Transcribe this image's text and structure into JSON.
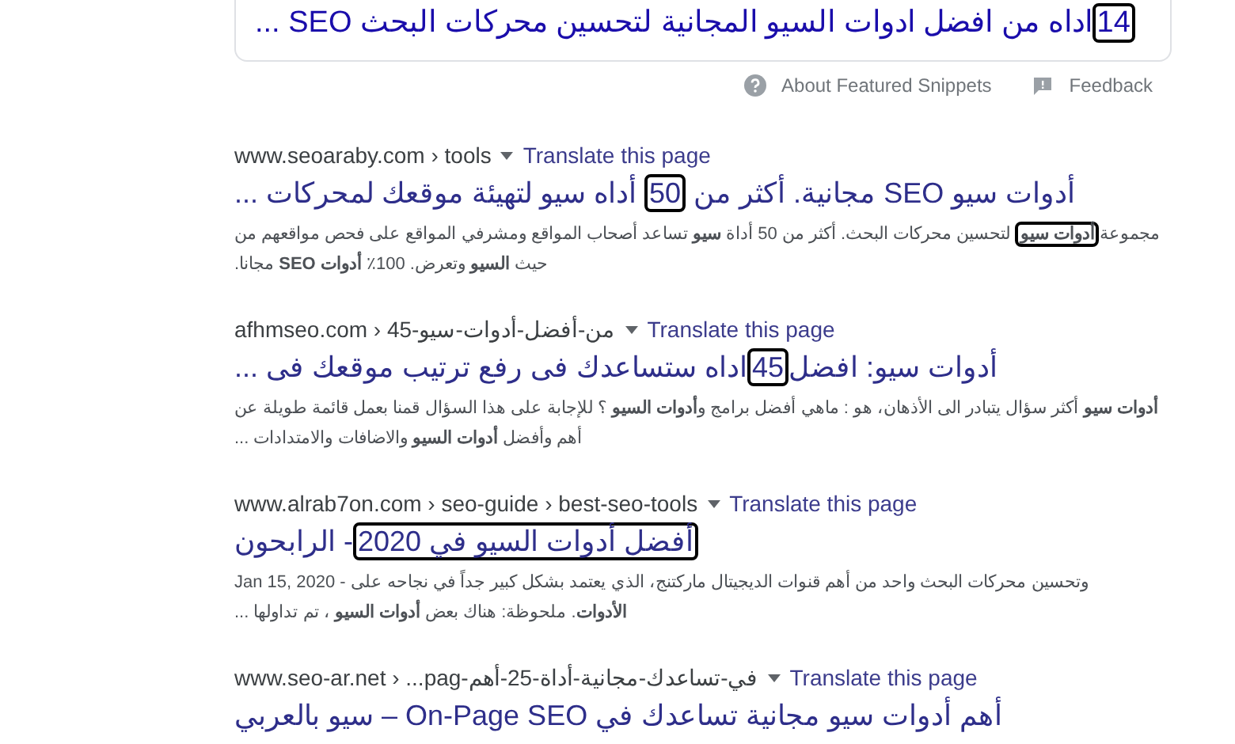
{
  "featured": {
    "title": [
      {
        "text": "14",
        "boxed": true
      },
      {
        "text": "اداه من افضل ادوات السيو المجانية لتحسين محركات البحث SEO ...",
        "boxed": false
      }
    ],
    "about_link": {
      "kind": "help",
      "label": "About Featured Snippets"
    },
    "feedback_link": {
      "kind": "feedback",
      "label": "Feedback"
    }
  },
  "results": [
    {
      "url": "www.seoaraby.com › tools",
      "translate": "Translate this page",
      "title": [
        {
          "text": "أدوات سيو SEO مجانية. أكثر من ",
          "boxed": false
        },
        {
          "text": "50",
          "boxed": true
        },
        {
          "text": " أداه سيو لتهيئة موقعك لمحركات ...",
          "boxed": false
        }
      ],
      "snippet": [
        [
          {
            "text": "مجموعة",
            "boxed": false
          },
          {
            "text": "**أدوات سيو**",
            "boxed": true
          },
          {
            "text": " لتحسين محركات البحث. أكثر من 50 أداة **سيو** تساعد أصحاب المواقع ومشرفي المواقع على فحص مواقعهم من",
            "boxed": false
          }
        ],
        [
          {
            "text": "حيث **السيو** وتعرض. 100٪ **أدوات SEO** مجانا.",
            "boxed": false
          }
        ]
      ]
    },
    {
      "url": "afhmseo.com › 45-من-أفضل-أدوات-سيو",
      "translate": "Translate this page",
      "title": [
        {
          "text": "أدوات سيو: افضل",
          "boxed": false
        },
        {
          "text": "45",
          "boxed": true
        },
        {
          "text": "اداه ستساعدك فى رفع ترتيب موقعك فى ...",
          "boxed": false
        }
      ],
      "snippet": [
        [
          {
            "text": "**أدوات سيو** أكثر سؤال يتبادر الى الأذهان، هو : ماهي أفضل برامج و**أدوات السيو** ؟ للإجابة على هذا السؤال قمنا بعمل قائمة طويلة عن",
            "boxed": false
          }
        ],
        [
          {
            "text": "أهم وأفضل **أدوات السيو** والاضافات والامتدادات ...",
            "boxed": false
          }
        ]
      ]
    },
    {
      "url": "www.alrab7on.com › seo-guide › best-seo-tools",
      "translate": "Translate this page",
      "title": [
        {
          "text": "أفضل أدوات السيو في 2020",
          "boxed": true
        },
        {
          "text": "- الرابحون",
          "boxed": false
        }
      ],
      "snippet": [
        [
          {
            "text": "Jan 15, 2020 - وتحسين محركات البحث واحد من أهم قنوات الديجيتال ماركتنج، الذي يعتمد بشكل كبير جداً في نجاحه على",
            "boxed": false
          }
        ],
        [
          {
            "text": "**الأدوات**. ملحوظة: هناك بعض **أدوات السيو** ، تم تداولها ...",
            "boxed": false
          }
        ]
      ]
    },
    {
      "url": "www.seo-ar.net › ...pag-في-تساعدك-مجانية-أداة-25-أهم",
      "translate": "Translate this page",
      "title": [
        {
          "text": "أهم أدوات سيو مجانية تساعدك في On-Page SEO – سيو بالعربي",
          "boxed": false
        }
      ]
    }
  ]
}
